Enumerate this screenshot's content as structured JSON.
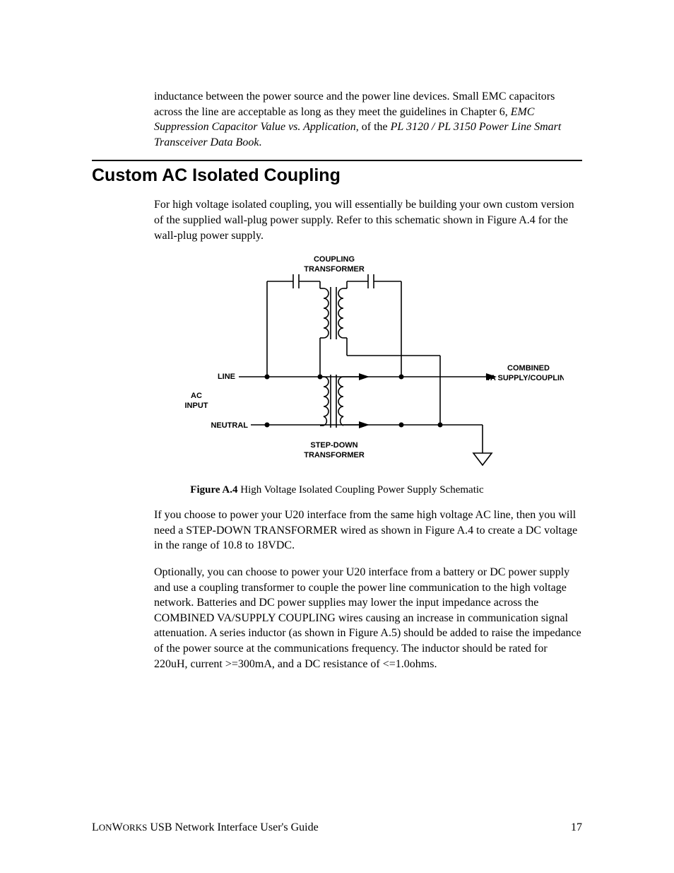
{
  "para1_a": "inductance between the power source and the power line devices.  Small EMC capacitors across the line are acceptable as long as they meet the guidelines in Chapter 6, ",
  "para1_b": "EMC Suppression Capacitor Value vs. Application",
  "para1_c": ", of the ",
  "para1_d": "PL 3120 / PL 3150 Power Line Smart Transceiver Data Book",
  "para1_e": ".",
  "heading": "Custom AC Isolated Coupling",
  "para2": "For high voltage isolated coupling, you will essentially be building your own custom version of the supplied wall-plug power supply.  Refer to this schematic shown in Figure A.4 for the wall-plug power supply.",
  "diagram": {
    "coupling_transformer": "COUPLING",
    "coupling_transformer2": "TRANSFORMER",
    "line": "LINE",
    "neutral": "NEUTRAL",
    "ac": "AC",
    "input": "INPUT",
    "stepdown1": "STEP-DOWN",
    "stepdown2": "TRANSFORMER",
    "combined": "COMBINED",
    "va_supply": "VA SUPPLY/COUPLING"
  },
  "caption_bold": "Figure A.4",
  "caption_rest": " High Voltage Isolated Coupling Power Supply Schematic",
  "para3": "If you choose to power your U20 interface from the same high voltage AC line, then you will need a STEP-DOWN TRANSFORMER wired as shown in Figure A.4 to create a DC voltage in the range of 10.8 to 18VDC.",
  "para4": "Optionally, you can choose to power your U20 interface from a battery or DC power supply and use a coupling transformer to couple the power line communication to the high voltage network.  Batteries and DC power supplies may lower the input impedance across the COMBINED VA/SUPPLY COUPLING wires causing an increase in communication signal attenuation.  A series inductor (as shown in Figure A.5) should be added to raise the impedance of the power source at the communications frequency.  The inductor should be rated for 220uH, current >=300mA, and a DC resistance of <=1.0ohms.",
  "footer_brand": "LonWorks",
  "footer_title": " USB Network Interface User's Guide",
  "page_number": "17"
}
